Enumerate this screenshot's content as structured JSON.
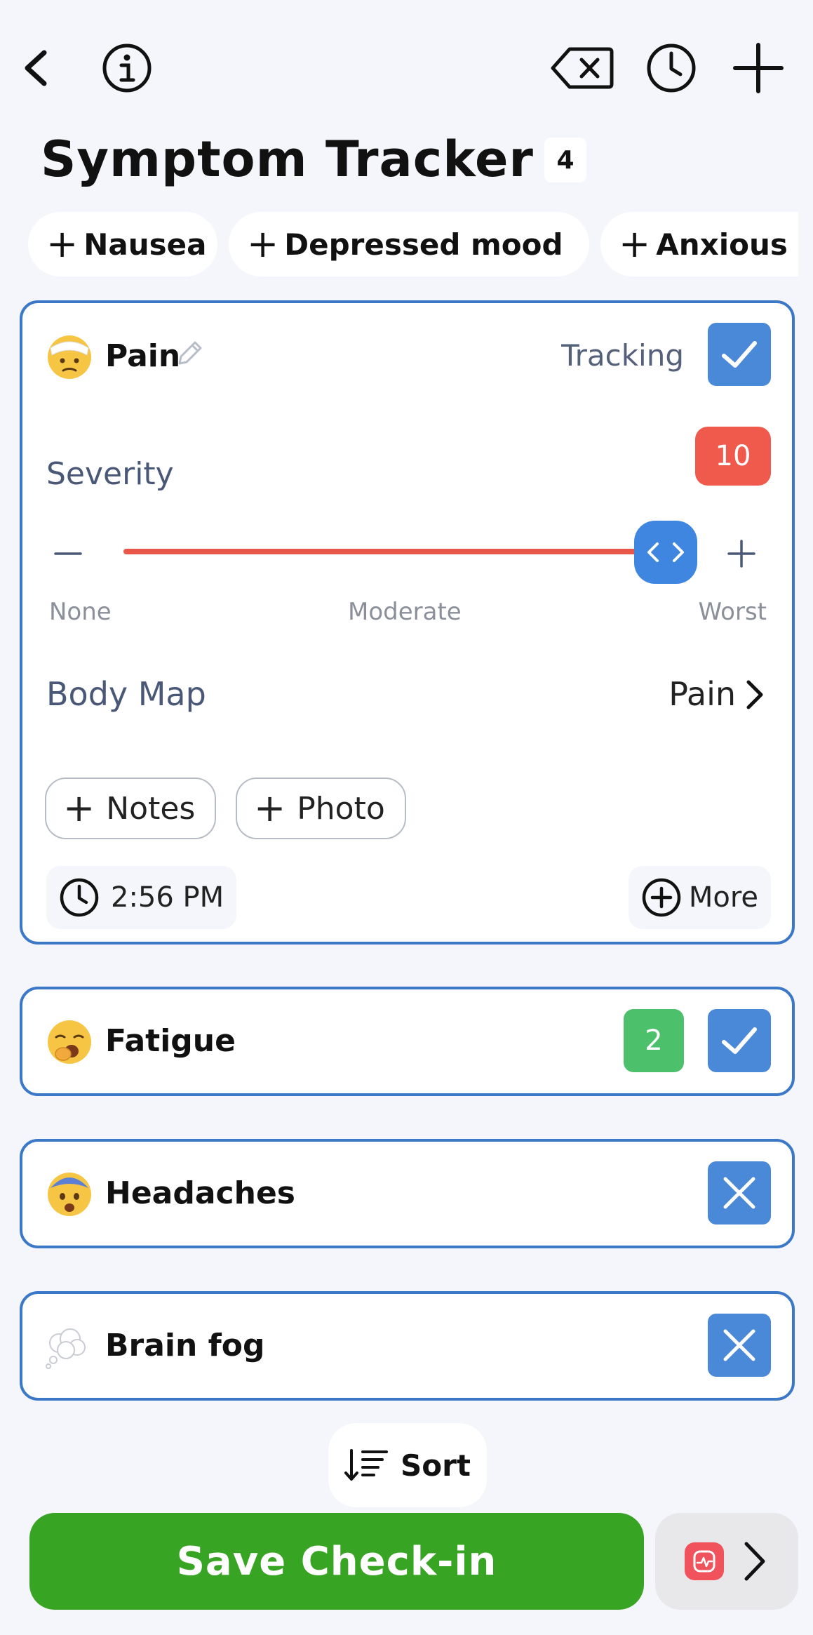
{
  "header": {
    "title": "Symptom Tracker",
    "count": "4"
  },
  "quick_add": [
    {
      "label": "Nausea"
    },
    {
      "label": "Depressed mood"
    },
    {
      "label": "Anxious mood"
    }
  ],
  "symptoms": [
    {
      "name": "Pain",
      "icon": "bandaged-face-icon",
      "tracking_label": "Tracking",
      "tracking": true,
      "severity_label": "Severity",
      "severity": "10",
      "severity_fraction": 1.0,
      "scale": {
        "min": "None",
        "mid": "Moderate",
        "max": "Worst"
      },
      "body_map_label": "Body Map",
      "body_map_value": "Pain",
      "notes_label": "Notes",
      "photo_label": "Photo",
      "time": "2:56 PM",
      "more_label": "More"
    },
    {
      "name": "Fatigue",
      "icon": "yawning-face-icon",
      "count": "2",
      "tracking": true
    },
    {
      "name": "Headaches",
      "icon": "anxious-face-icon",
      "tracking": false
    },
    {
      "name": "Brain fog",
      "icon": "thought-balloon-icon",
      "tracking": false
    }
  ],
  "footer": {
    "sort_label": "Sort",
    "save_label": "Save Check-in"
  },
  "colors": {
    "accent_blue": "#4a88d8",
    "card_border": "#3c78c8",
    "severity_red": "#ef5a4c",
    "save_green": "#38a424",
    "count_green": "#4cc06a"
  }
}
